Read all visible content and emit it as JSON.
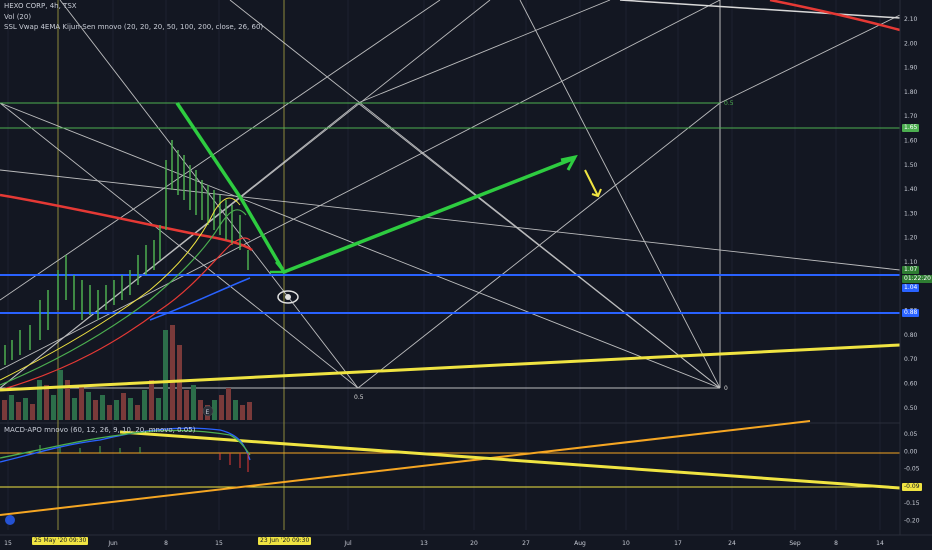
{
  "legend": {
    "title": "HEXO CORP, 4h, TSX",
    "vol": "Vol (20)",
    "ssl": "SSL Vwap 4EMA Kijun-Sen mnovo (20, 20, 20, 50, 100, 200, close, 26, 60)",
    "macd": "MACD-APO mnovo (60, 12, 26, 9, 10, 20, mnovo, 0.05)"
  },
  "price_axis": [
    "2.10",
    "2.00",
    "1.90",
    "1.80",
    "1.70",
    "1.60",
    "1.50",
    "1.40",
    "1.30",
    "1.20",
    "1.10",
    "1.00",
    "0.90",
    "0.80",
    "0.70",
    "0.60",
    "0.50"
  ],
  "macd_axis": [
    "0.05",
    "0.00",
    "-0.05",
    "-0.10",
    "-0.15",
    "-0.20"
  ],
  "time_axis": [
    "15",
    "Jun",
    "8",
    "15",
    "Jul",
    "13",
    "20",
    "27",
    "Aug",
    "10",
    "17",
    "24",
    "Sep",
    "8",
    "14"
  ],
  "time_badges": {
    "left": "25 May '20  09:30",
    "right": "23 Jun '20  09:30"
  },
  "price_badges": {
    "green": "1.65",
    "price": "1.07",
    "countdown": "01:22:20",
    "blue1": "1.04",
    "blue2": "0.88",
    "macd_val": "-0.09"
  },
  "fib_labels": {
    "top": "0.5",
    "bottom_mid": "0.5",
    "bottom_right": "0"
  },
  "colors": {
    "bg": "#131722",
    "green": "#4caf50",
    "red": "#e53935",
    "blue": "#2962ff",
    "yellow": "#f0e442",
    "orange": "#f5a623",
    "white": "#d9d9d9"
  }
}
